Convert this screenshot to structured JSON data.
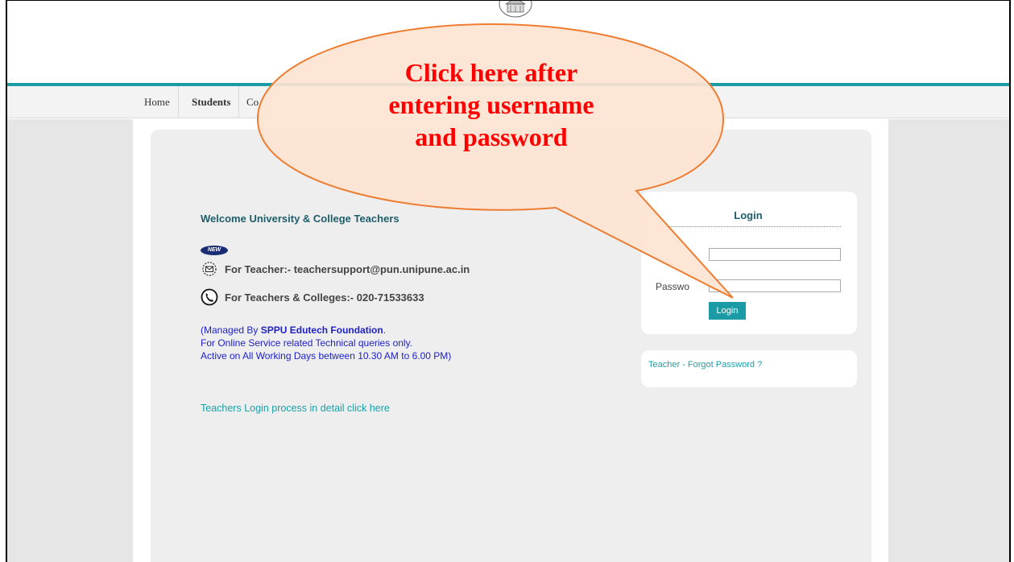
{
  "nav": {
    "home": "Home",
    "students": "Students",
    "colleges": "Co"
  },
  "welcome": "Welcome University & College Teachers",
  "new_badge": "NEW",
  "contacts": {
    "email": "For Teacher:- teachersupport@pun.unipune.ac.in",
    "phone": "For Teachers & Colleges:- 020-71533633"
  },
  "info": {
    "managed_prefix": "(Managed By ",
    "managed_org": "SPPU Edutech Foundation",
    "managed_suffix": ".",
    "line2": "For Online Service related Technical queries only.",
    "line3": "Active on All Working Days between 10.30 AM to 6.00 PM)"
  },
  "process_link": "Teachers Login process in detail click here",
  "login": {
    "title": "Login",
    "password_label": "Passwo",
    "username_value": "",
    "password_value": "",
    "button": "Login"
  },
  "forgot_link": "Teacher - Forgot Password ?",
  "callout": {
    "line1": "Click here after",
    "line2": "entering username",
    "line3": "and password"
  },
  "colors": {
    "teal": "#1a9ba5",
    "callout_text": "#ff0000",
    "callout_border": "#ed7d31"
  }
}
